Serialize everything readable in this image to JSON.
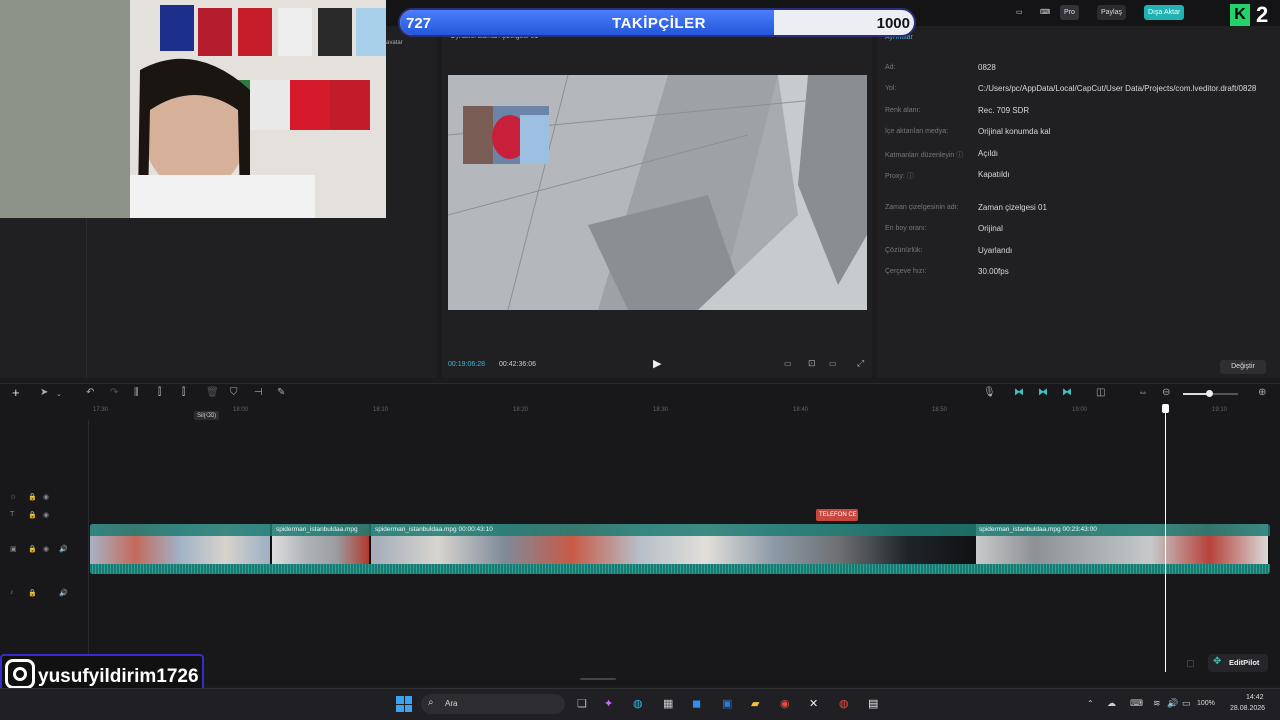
{
  "follower_goal": {
    "current": "727",
    "title": "TAKİPÇİLER",
    "goal": "1000",
    "progress_fraction": 0.727
  },
  "stream_badge": "2",
  "topbar": {
    "pro_label": "Pro",
    "share_label": "Paylaş",
    "export_label": "Dışa Aktar"
  },
  "media_panel": {
    "tab_label": "avatar"
  },
  "player": {
    "header_text": "Oynatıcı Zaman çizelgesi 01",
    "current_time": "00:19:06:28",
    "total_time": "00:42:36:06"
  },
  "properties": {
    "header": "Ayrıntılar",
    "rows": [
      {
        "label": "Ad:",
        "value": "0828"
      },
      {
        "label": "Yol:",
        "value": "C:/Users/pc/AppData/Local/CapCut/User Data/Projects/com.lveditor.draft/0828"
      },
      {
        "label": "Renk alanı:",
        "value": "Rec. 709 SDR"
      },
      {
        "label": "İçe aktarılan medya:",
        "value": "Orijinal konumda kal"
      },
      {
        "label": "Katmanları düzenleyin ⓘ",
        "value": "Açıldı"
      },
      {
        "label": "Proxy: ⓘ",
        "value": "Kapatıldı"
      },
      {
        "label": "Zaman çizelgesinin adı:",
        "value": "Zaman çizelgesi 01"
      },
      {
        "label": "En boy oranı:",
        "value": "Orijinal"
      },
      {
        "label": "Çözünürlük:",
        "value": "Uyarlandı"
      },
      {
        "label": "Çerçeve hızı:",
        "value": "30.00fps"
      }
    ],
    "change_button": "Değiştir"
  },
  "timeline": {
    "tooltip_delete": "Sil(⌫)",
    "ruler": [
      "17:30",
      "18:00",
      "18:10",
      "18:20",
      "18:30",
      "18:40",
      "18:50",
      "19:00",
      "19:10"
    ],
    "marker_label": "TELEFON CE",
    "clips": [
      {
        "name": ""
      },
      {
        "name": "spiderman_istanbuldaa.mpg"
      },
      {
        "name": "spiderman_istanbuldaa.mpg   00:00:43:10"
      },
      {
        "name": "spiderman_istanbuldaa.mpg   00:23:43:00"
      }
    ]
  },
  "editpilot_label": "EditPilot",
  "instagram_handle": "yusufyildirim1726",
  "taskbar": {
    "search_label": "Ara",
    "battery": "100%",
    "time": "14:42",
    "date": "28.08.2026"
  },
  "colors": {
    "accent": "#3b7cff",
    "export_button": "#21b3b3",
    "clip_track": "#1f7c74",
    "marker": "#c9463d",
    "playhead": "#ffffff"
  },
  "icons": [
    "webcam-feed",
    "play-icon",
    "undo-icon",
    "redo-icon",
    "split-icon",
    "delete-icon",
    "mic-icon",
    "zoom-out-icon",
    "zoom-in-icon",
    "eye-icon",
    "lock-icon",
    "audio-icon",
    "instagram-icon",
    "windows-start-icon",
    "search-icon"
  ]
}
